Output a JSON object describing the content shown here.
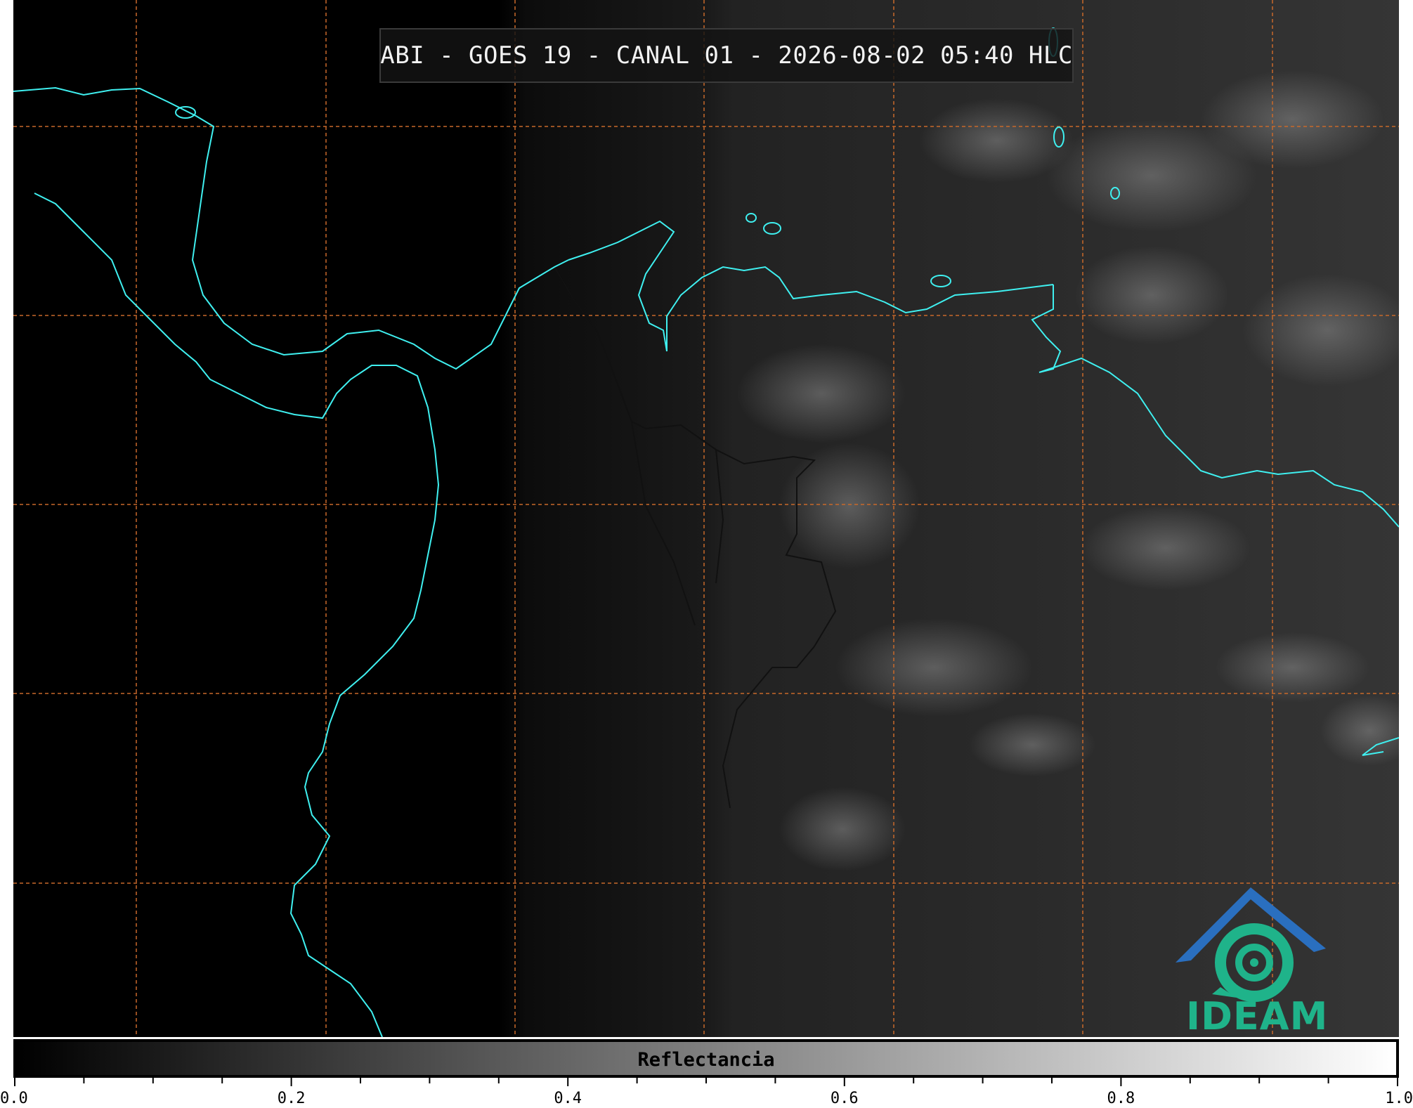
{
  "title": "ABI - GOES 19 - CANAL 01 - 2026-08-02 05:40 HLC",
  "logo": {
    "icon": "ideam-logo-icon",
    "text": "IDEAM",
    "colors": {
      "roof": "#2a6fbf",
      "swirl": "#1fb38a"
    }
  },
  "colorbar": {
    "label": "Reflectancia",
    "min": 0.0,
    "max": 1.0,
    "tick_labels": [
      "0.0",
      "0.2",
      "0.4",
      "0.6",
      "0.8",
      "1.0"
    ],
    "major_ticks": [
      0.0,
      0.2,
      0.4,
      0.6,
      0.8,
      1.0
    ],
    "colormap": [
      "#000000",
      "#ffffff"
    ]
  },
  "map": {
    "grid": true,
    "grid_color": "#c8692a",
    "coastline_color": "#3ff0f0",
    "border_color": "#111111"
  }
}
